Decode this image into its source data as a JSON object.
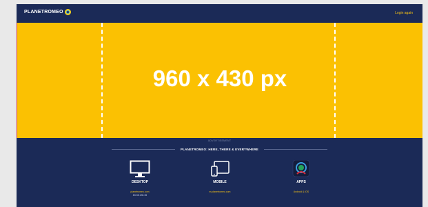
{
  "header": {
    "logo_planet": "PLANET",
    "logo_romeo": "ROMEO",
    "login_label": "Login again"
  },
  "banner": {
    "text": "960 x 430 px"
  },
  "advertisement_label": "ADVERTISEMENT",
  "footer": {
    "tagline": "PLANETROMEO: HERE, THERE & EVERYWHERE",
    "desktop": {
      "title": "DESKTOP",
      "link": "planetromeo.com",
      "sub": "83.98.135.35"
    },
    "mobile": {
      "title": "MOBILE",
      "link": "m.planetromeo.com"
    },
    "apps": {
      "title": "APPS",
      "link": "Android & iOS"
    }
  },
  "colors": {
    "navy": "#1b2a57",
    "banner_yellow": "#fbc102",
    "accent_yellow": "#f6c214"
  },
  "icons": [
    "desktop-icon",
    "mobile-tablet-icon",
    "planetromeo-app-icon"
  ]
}
